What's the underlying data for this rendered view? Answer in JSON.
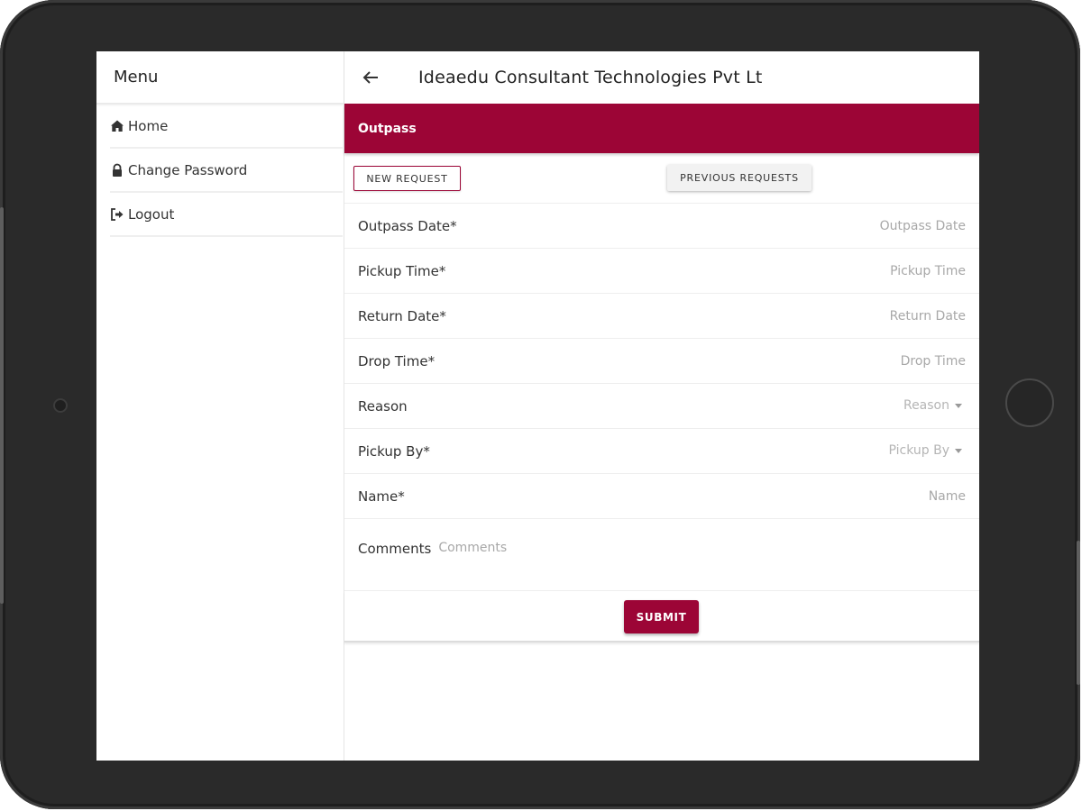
{
  "sidebar": {
    "title": "Menu",
    "items": [
      {
        "label": "Home",
        "icon": "home-icon"
      },
      {
        "label": "Change Password",
        "icon": "lock-icon"
      },
      {
        "label": "Logout",
        "icon": "logout-icon"
      }
    ]
  },
  "header": {
    "back_icon": "arrow-left-icon",
    "title": "Ideaedu Consultant Technologies Pvt Lt"
  },
  "section": {
    "title": "Outpass"
  },
  "tabs": {
    "new_request": "NEW REQUEST",
    "previous_requests": "PREVIOUS REQUESTS"
  },
  "form": {
    "outpass_date": {
      "label": "Outpass Date*",
      "placeholder": "Outpass Date",
      "value": ""
    },
    "pickup_time": {
      "label": "Pickup Time*",
      "placeholder": "Pickup Time",
      "value": ""
    },
    "return_date": {
      "label": "Return Date*",
      "placeholder": "Return Date",
      "value": ""
    },
    "drop_time": {
      "label": "Drop Time*",
      "placeholder": "Drop Time",
      "value": ""
    },
    "reason": {
      "label": "Reason",
      "placeholder": "Reason"
    },
    "pickup_by": {
      "label": "Pickup By*",
      "placeholder": "Pickup By"
    },
    "name": {
      "label": "Name*",
      "placeholder": "Name",
      "value": ""
    },
    "comments": {
      "label": "Comments",
      "placeholder": "Comments",
      "value": ""
    },
    "submit_label": "SUBMIT"
  },
  "colors": {
    "accent": "#9c0536",
    "device_frame": "#2a2a2a"
  }
}
